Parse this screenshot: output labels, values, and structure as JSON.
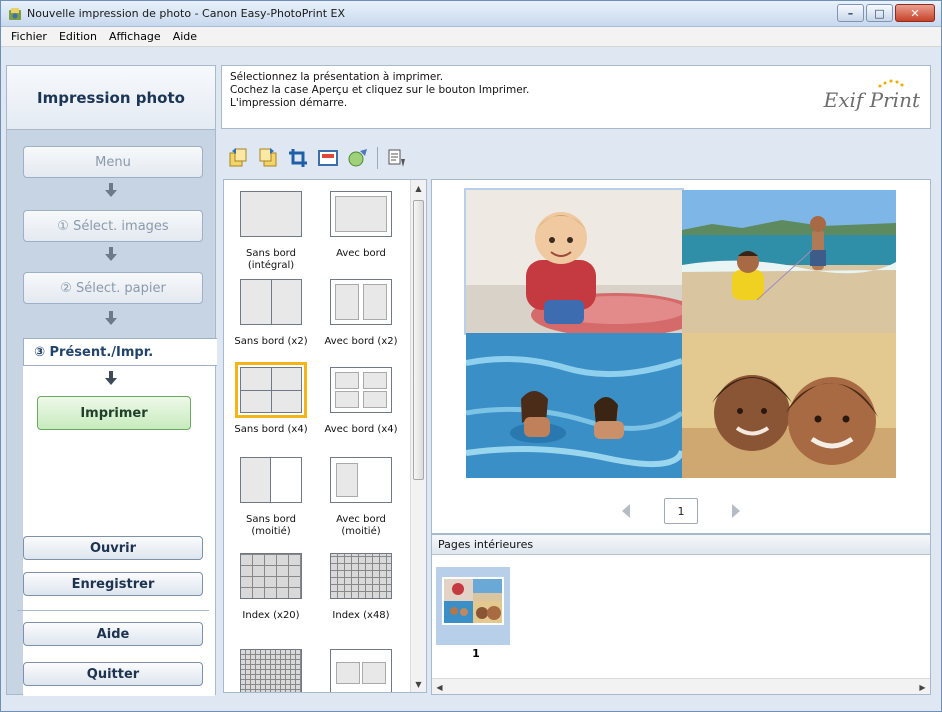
{
  "window": {
    "title": "Nouvelle impression de photo - Canon Easy-PhotoPrint EX",
    "controls": {
      "minimize": "–",
      "maximize": "□",
      "close": "✕"
    }
  },
  "menu": [
    "Fichier",
    "Edition",
    "Affichage",
    "Aide"
  ],
  "sidebar": {
    "header": "Impression photo",
    "steps": {
      "menu": "Menu",
      "select_images": "① Sélect. images",
      "select_paper": "② Sélect. papier",
      "layout_print": "③ Présent./Impr."
    },
    "print_button": "Imprimer",
    "commands": {
      "open": "Ouvrir",
      "save": "Enregistrer",
      "help": "Aide",
      "quit": "Quitter"
    }
  },
  "instructions": {
    "lines": [
      "Sélectionnez la présentation à imprimer.",
      "Cochez la case Aperçu et cliquez sur le bouton Imprimer.",
      "L'impression démarre."
    ],
    "logo": "Exif Print"
  },
  "toolbar": {
    "icons": [
      "rotate-left-icon",
      "rotate-right-icon",
      "crop-icon",
      "frame-icon",
      "date-settings-icon",
      "layout-print-settings-icon"
    ]
  },
  "layouts": [
    {
      "label": "Sans bord (intégral)"
    },
    {
      "label": "Avec bord"
    },
    {
      "label": "Sans bord (x2)"
    },
    {
      "label": "Avec bord (x2)"
    },
    {
      "label": "Sans bord (x4)",
      "selected": true
    },
    {
      "label": "Avec bord (x4)"
    },
    {
      "label": "Sans bord (moitié)"
    },
    {
      "label": "Avec bord (moitié)"
    },
    {
      "label": "Index (x20)"
    },
    {
      "label": "Index (x48)"
    }
  ],
  "preview": {
    "page_number": "1",
    "photos": [
      "child-on-float-photo",
      "beach-kids-photo",
      "kids-in-sea-photo",
      "smiling-children-photo"
    ]
  },
  "pages_panel": {
    "header": "Pages intérieures",
    "page_number": "1"
  },
  "colors": {
    "accent": "#f4b41a",
    "sidebar_bg": "#c6d4e3",
    "print_button": "#c7ebbd"
  }
}
